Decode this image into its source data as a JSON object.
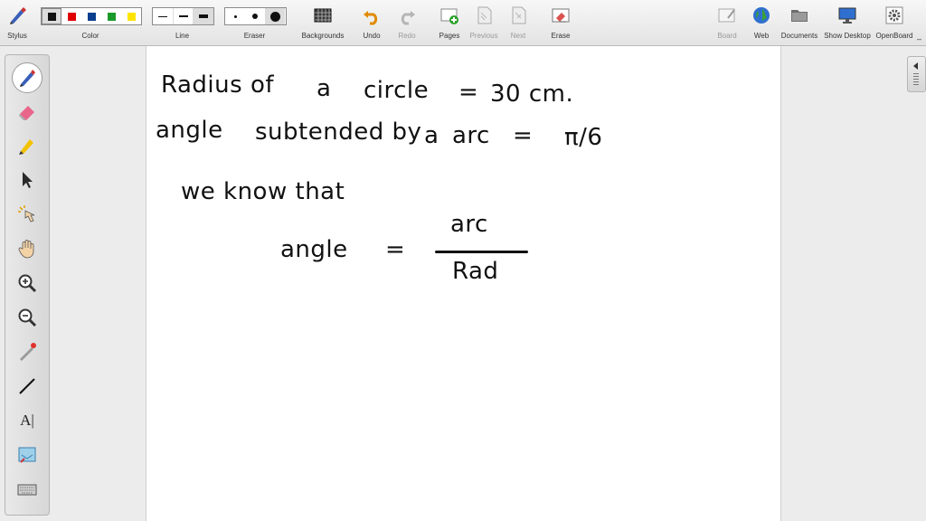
{
  "toolbar": {
    "stylus_label": "Stylus",
    "color_label": "Color",
    "line_label": "Line",
    "eraser_label": "Eraser",
    "backgrounds_label": "Backgrounds",
    "undo_label": "Undo",
    "redo_label": "Redo",
    "pages_label": "Pages",
    "previous_label": "Previous",
    "next_label": "Next",
    "erase_label": "Erase",
    "board_label": "Board",
    "web_label": "Web",
    "documents_label": "Documents",
    "show_desktop_label": "Show Desktop",
    "openboard_label": "OpenBoard"
  },
  "colors": {
    "swatches": [
      "#111111",
      "#e00000",
      "#0a3f8f",
      "#1a9a2a",
      "#ffe400"
    ],
    "selected_index": 0,
    "accent": "#0a3f8f"
  },
  "tools": {
    "left_panel": [
      "pen-icon",
      "eraser-icon",
      "marker-icon",
      "selector-icon",
      "interactor-icon",
      "hand-icon",
      "zoom-in-icon",
      "zoom-out-icon",
      "laser-pointer-icon",
      "line-icon",
      "text-icon",
      "capture-icon",
      "keyboard-icon"
    ],
    "text_tool_glyph": "A|"
  },
  "board": {
    "line1_a": "Radius of",
    "line1_b": "a",
    "line1_c": "circle",
    "line1_d": "=",
    "line1_e": "30 cm.",
    "line2_a": "angle",
    "line2_b": "subtended by",
    "line2_c": "a",
    "line2_d": "arc",
    "line2_e": "=",
    "line2_f": "π/6",
    "line3": "we know that",
    "eq_lhs": "angle",
    "eq_equals": "=",
    "eq_numerator": "arc",
    "eq_denominator": "Rad"
  }
}
